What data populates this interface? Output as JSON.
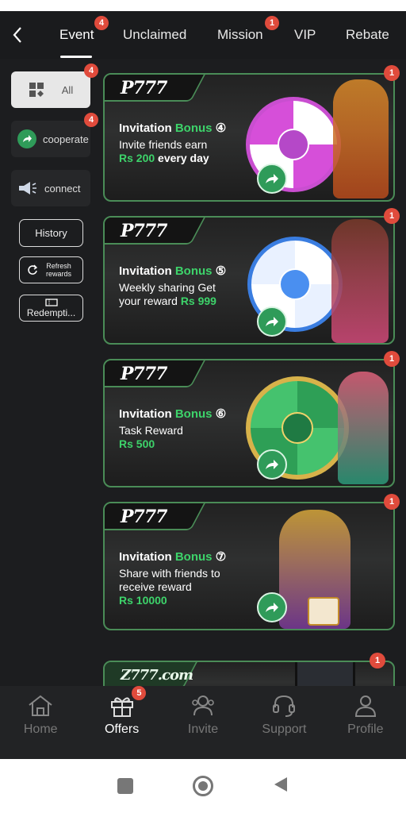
{
  "topnav": {
    "tabs": [
      {
        "label": "Event",
        "badge": "4",
        "active": true
      },
      {
        "label": "Unclaimed"
      },
      {
        "label": "Mission",
        "badge": "1"
      },
      {
        "label": "VIP"
      },
      {
        "label": "Rebate"
      }
    ]
  },
  "sidebar": {
    "items": [
      {
        "label": "All",
        "badge": "4",
        "icon": "grid-icon"
      },
      {
        "label": "cooperate",
        "badge": "4",
        "icon": "share-icon"
      },
      {
        "label": "connect",
        "icon": "megaphone-icon"
      }
    ],
    "history_label": "History",
    "refresh_label": "Refresh rewards",
    "redemption_label": "Redempti..."
  },
  "cards": [
    {
      "logo": "P777",
      "title_a": "Invitation ",
      "title_b": "Bonus",
      "num": "④",
      "line1": "Invite friends earn",
      "amount": "Rs 200",
      "line2_suffix": " every day",
      "badge": "1"
    },
    {
      "logo": "P777",
      "title_a": "Invitation ",
      "title_b": "Bonus",
      "num": "⑤",
      "line1": "Weekly sharing Get",
      "line2_prefix": "your reward ",
      "amount": "Rs 999",
      "badge": "1"
    },
    {
      "logo": "P777",
      "title_a": "Invitation ",
      "title_b": "Bonus",
      "num": "⑥",
      "line1": "Task Reward",
      "amount": "Rs 500",
      "badge": "1"
    },
    {
      "logo": "P777",
      "title_a": "Invitation ",
      "title_b": "Bonus",
      "num": "⑦",
      "line1": "Share with friends to",
      "line2": "receive reward",
      "amount": "Rs 10000",
      "badge": "1"
    },
    {
      "logo": "Z777.com",
      "badge": "1"
    }
  ],
  "bottomnav": {
    "items": [
      {
        "label": "Home",
        "icon": "home-icon"
      },
      {
        "label": "Offers",
        "icon": "gift-icon",
        "badge": "5",
        "active": true
      },
      {
        "label": "Invite",
        "icon": "people-icon"
      },
      {
        "label": "Support",
        "icon": "headset-icon"
      },
      {
        "label": "Profile",
        "icon": "person-icon"
      }
    ]
  },
  "colors": {
    "accent_green": "#3dd36a",
    "badge_red": "#e04b3c",
    "card_border": "#4a8c57"
  }
}
